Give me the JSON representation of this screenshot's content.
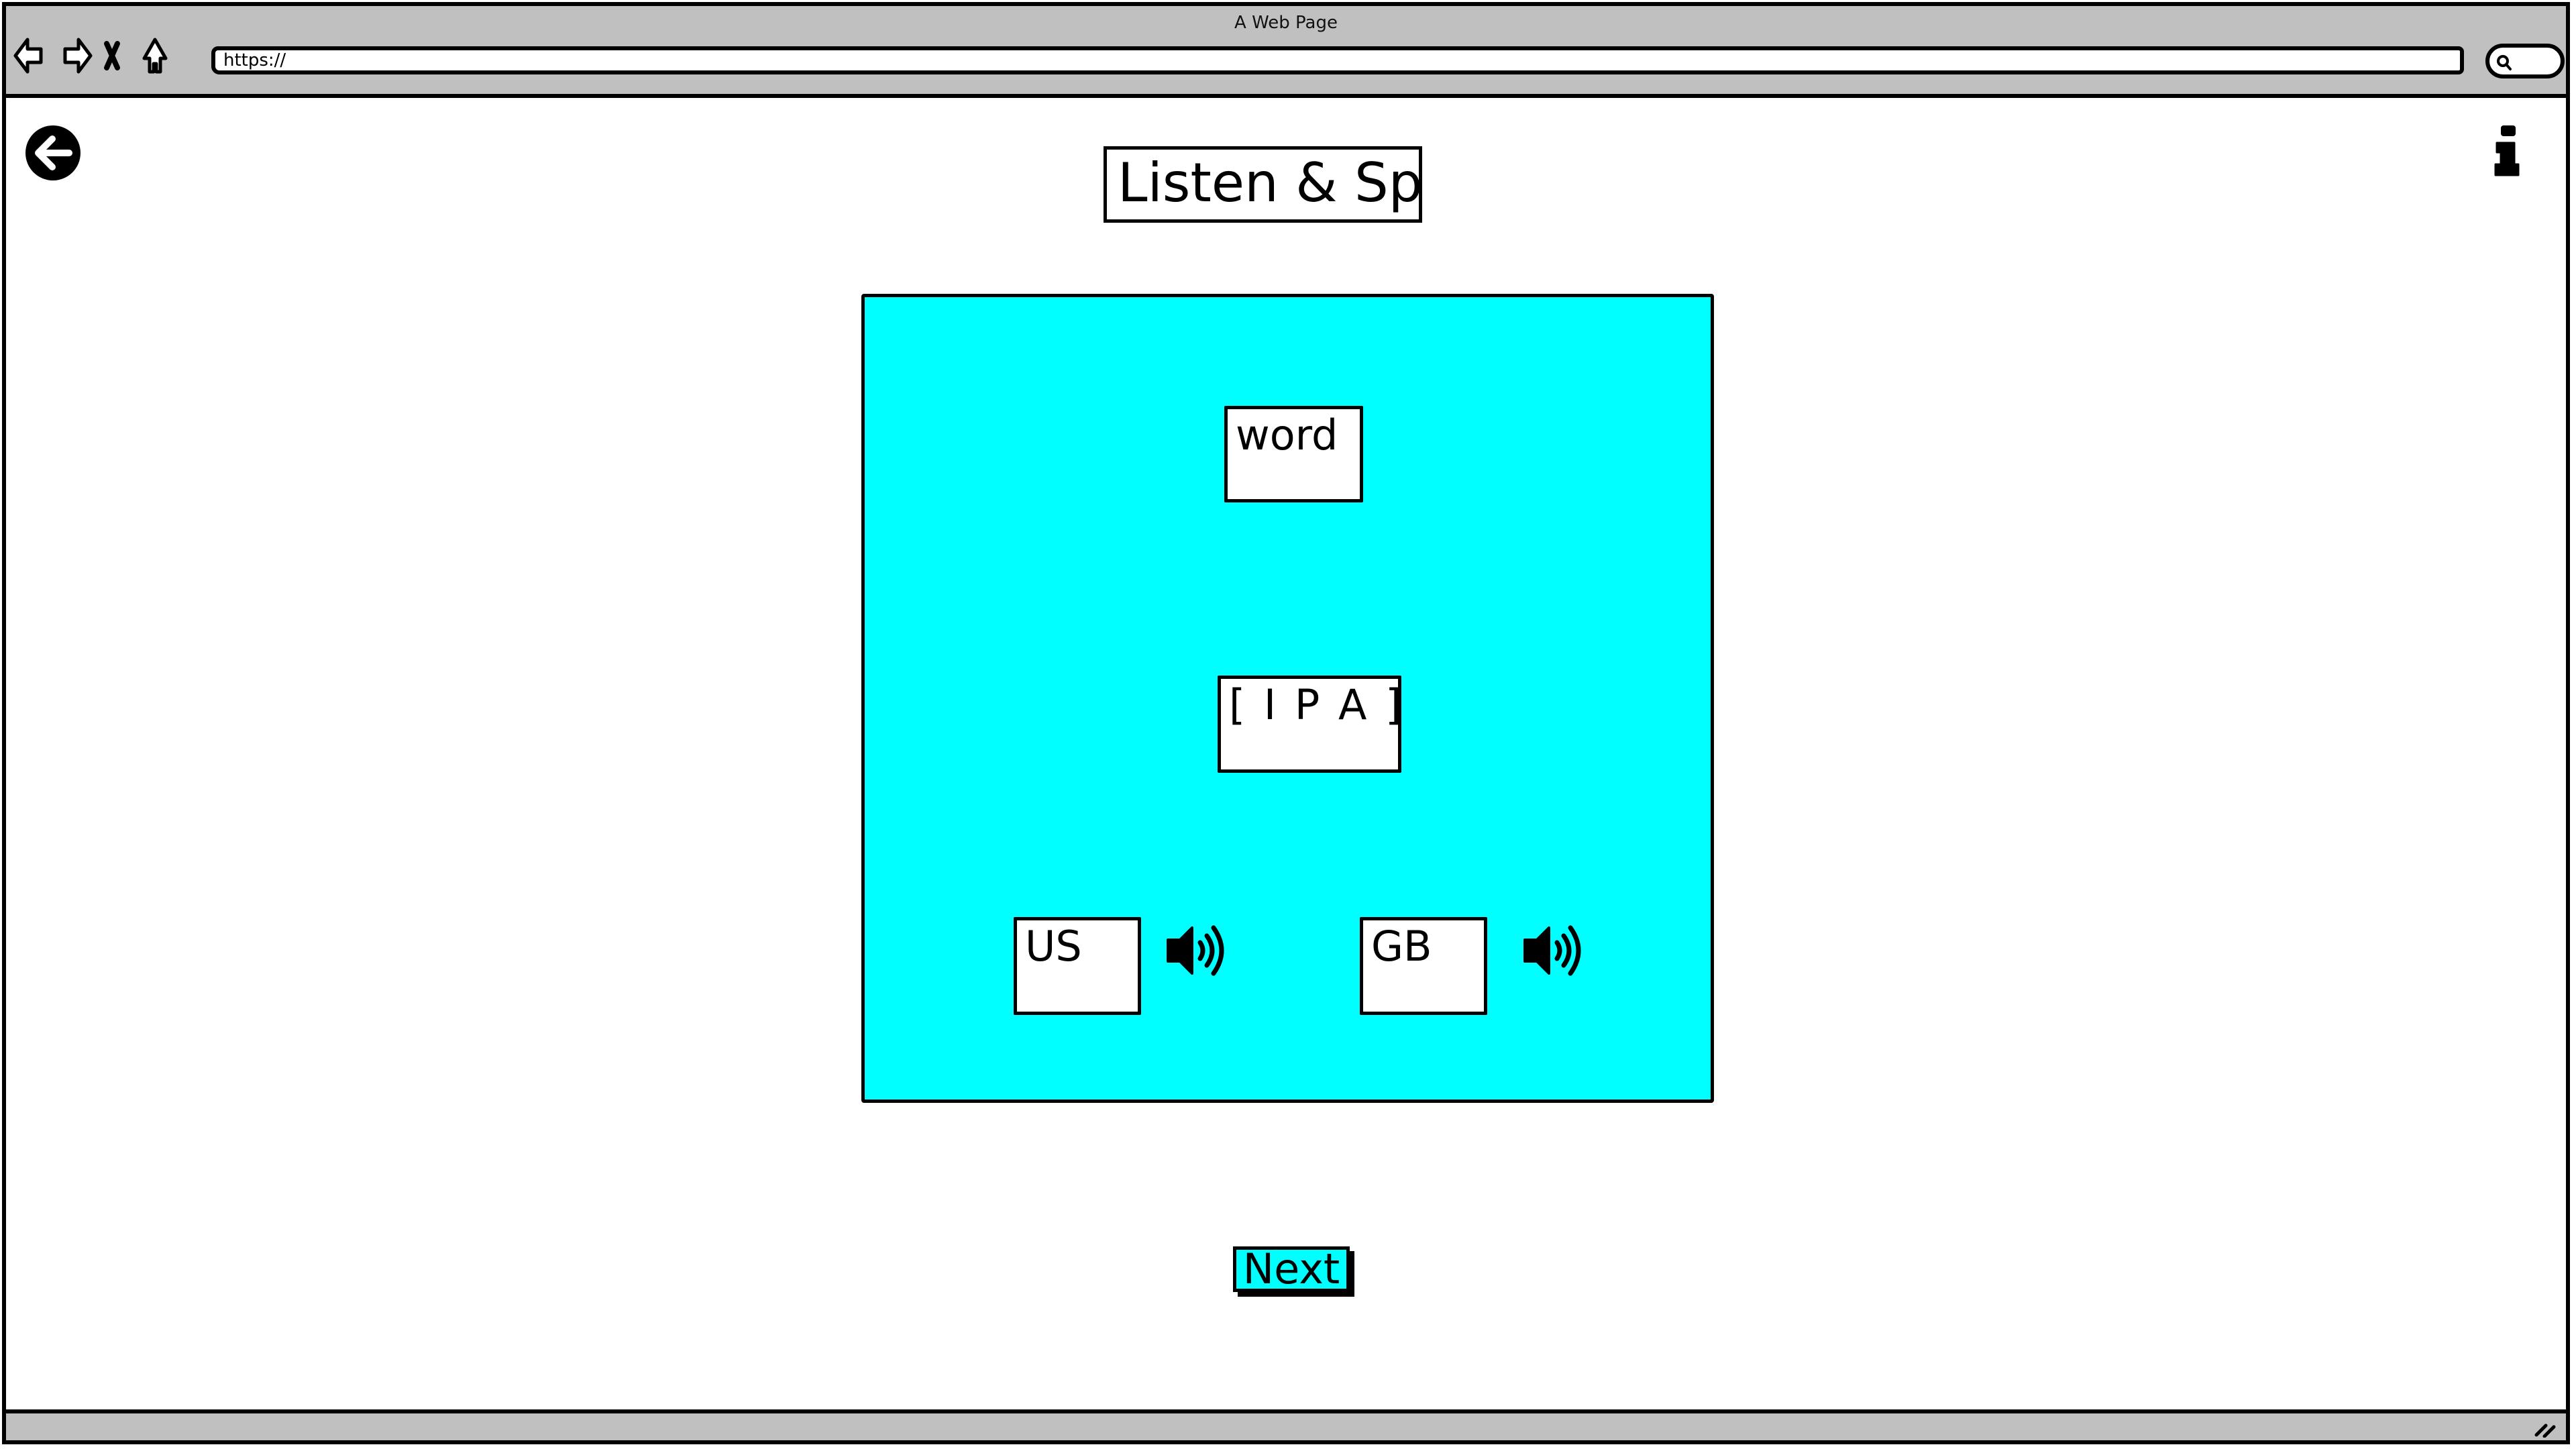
{
  "browser": {
    "window_title": "A Web Page",
    "url": "https://",
    "nav_icons": [
      "back-arrow-icon",
      "forward-arrow-icon",
      "stop-icon",
      "home-icon"
    ],
    "search_icon": "search-icon"
  },
  "header": {
    "back_icon": "circle-arrow-left-icon",
    "title": "Listen & Spell",
    "info_icon": "info-icon"
  },
  "panel": {
    "background": "#00FFFF",
    "word": "word",
    "ipa": "[ I P A ]",
    "pronunciations": [
      {
        "label": "US",
        "icon": "speaker-icon"
      },
      {
        "label": "GB",
        "icon": "speaker-icon"
      }
    ]
  },
  "footer": {
    "next_label": "Next",
    "next_color": "#00FFFF"
  }
}
